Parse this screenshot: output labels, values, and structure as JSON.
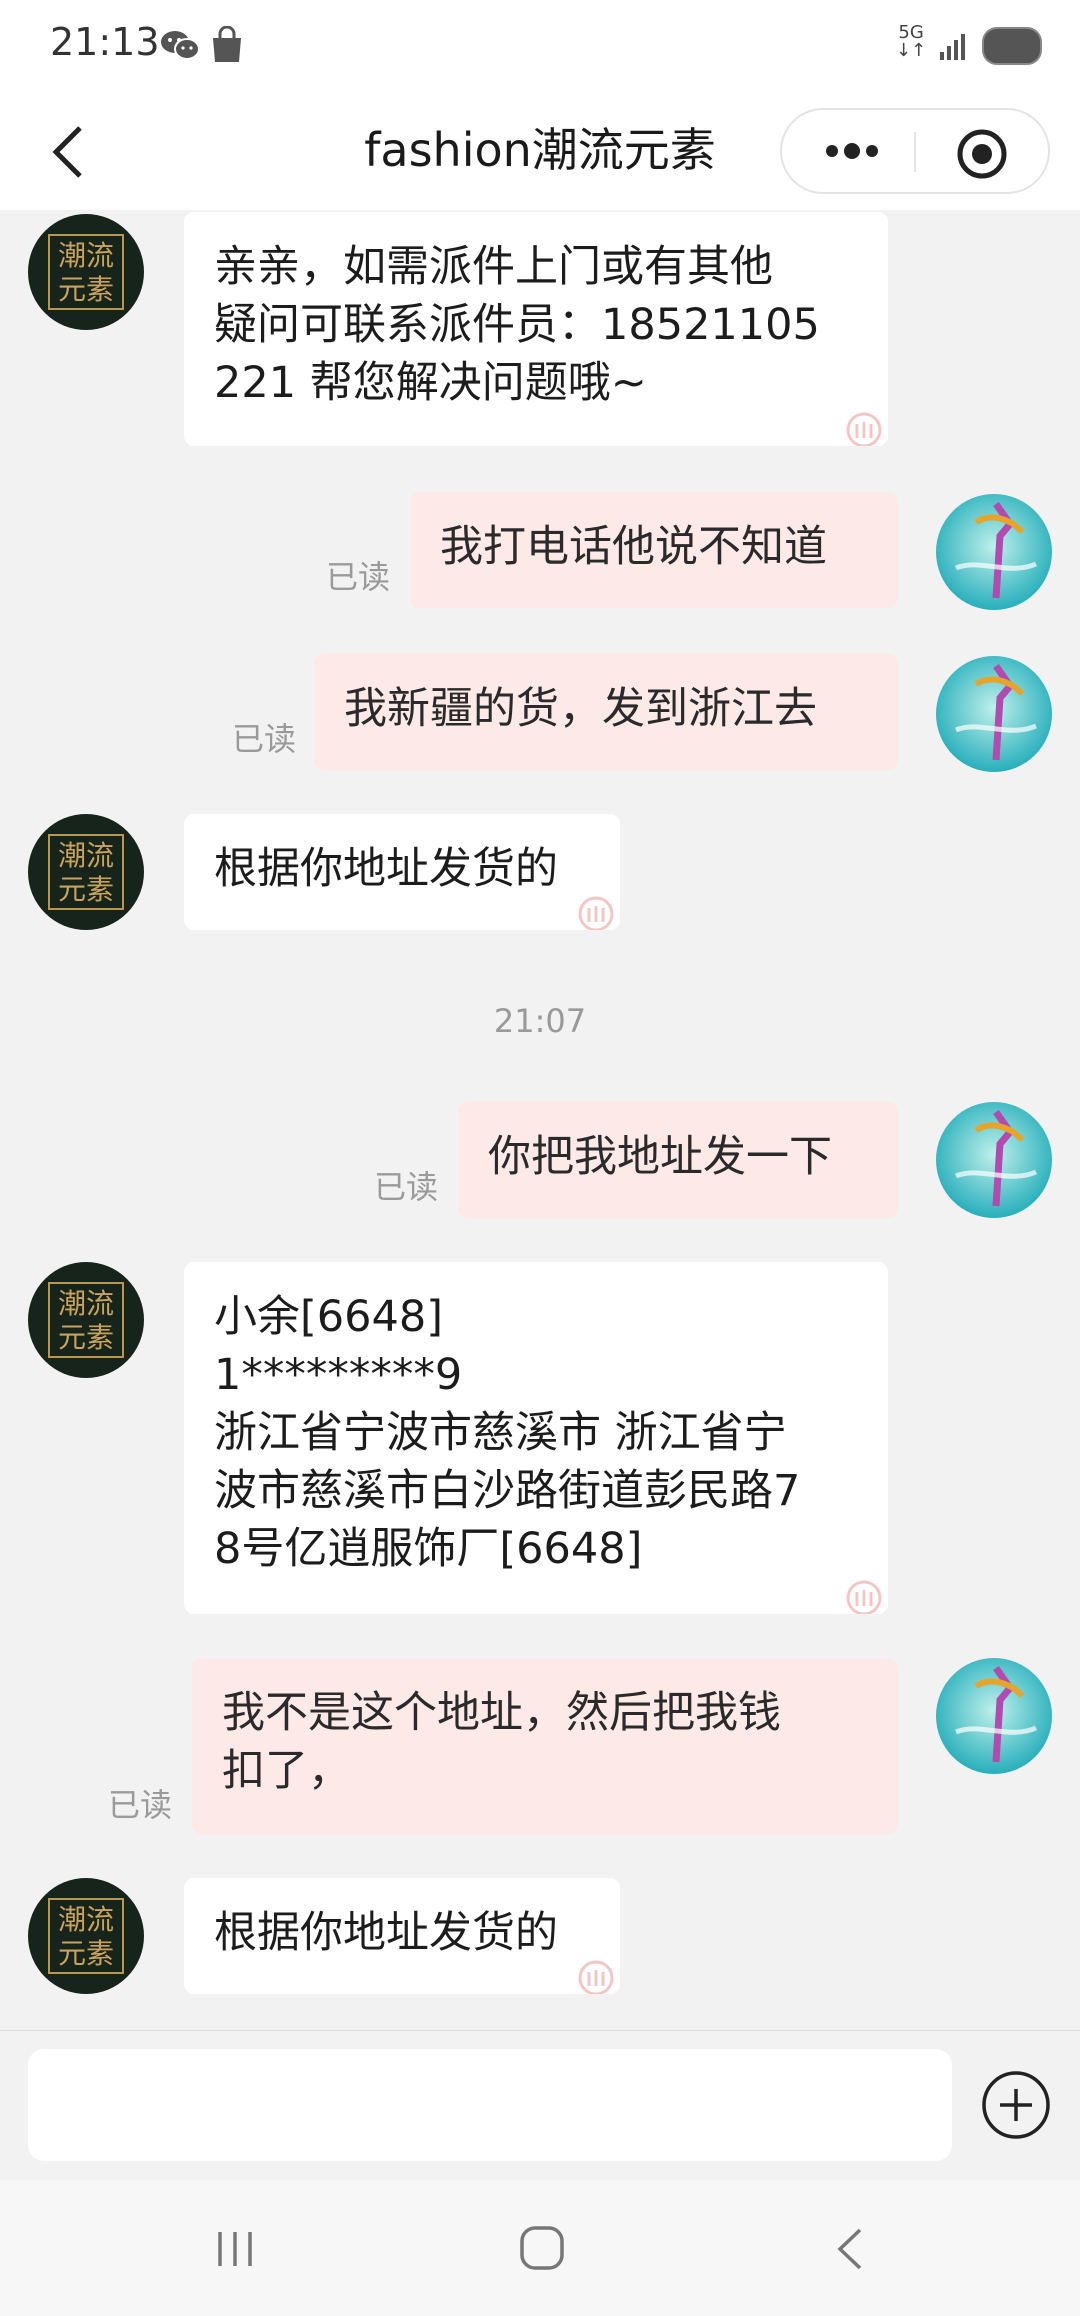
{
  "status_bar": {
    "time": "21:13",
    "network": "5G",
    "icons": [
      "wechat-icon",
      "shopping-bag-icon",
      "signal-icon",
      "battery-icon"
    ]
  },
  "nav": {
    "title": "fashion潮流元素",
    "back_icon": "back-chevron-icon",
    "more_icon": "more-dots-icon",
    "close_icon": "record-close-icon"
  },
  "shop_avatar_text": [
    "潮流",
    "元素"
  ],
  "messages": [
    {
      "side": "left",
      "text": "亲亲，如需派件上门或有其他\n疑问可联系派件员：18521105\n221 帮您解决问题哦~"
    },
    {
      "side": "right",
      "text": "我打电话他说不知道",
      "status": "已读"
    },
    {
      "side": "right",
      "text": "我新疆的货，发到浙江去",
      "status": "已读"
    },
    {
      "side": "left",
      "text": "根据你地址发货的"
    },
    {
      "type": "time",
      "text": "21:07"
    },
    {
      "side": "right",
      "text": "你把我地址发一下",
      "status": "已读"
    },
    {
      "side": "left",
      "text": "小余[6648]\n1*********9\n浙江省宁波市慈溪市 浙江省宁\n波市慈溪市白沙路街道彭民路7\n8号亿逍服饰厂[6648]"
    },
    {
      "side": "right",
      "text": "我不是这个地址，然后把我钱\n扣了，",
      "status": "已读"
    },
    {
      "side": "left",
      "text": "根据你地址发货的"
    }
  ],
  "input": {
    "placeholder": "",
    "plus_icon": "plus-circle-icon"
  },
  "system_nav": [
    "recent-apps-icon",
    "home-icon",
    "back-icon"
  ],
  "colors": {
    "chat_bg": "#f2f2f2",
    "self_bubble": "#fde9e8",
    "other_bubble": "#ffffff",
    "read_text": "#9a9a9a",
    "avatar_gold": "#c9a25c",
    "avatar_dark": "#17241c"
  }
}
